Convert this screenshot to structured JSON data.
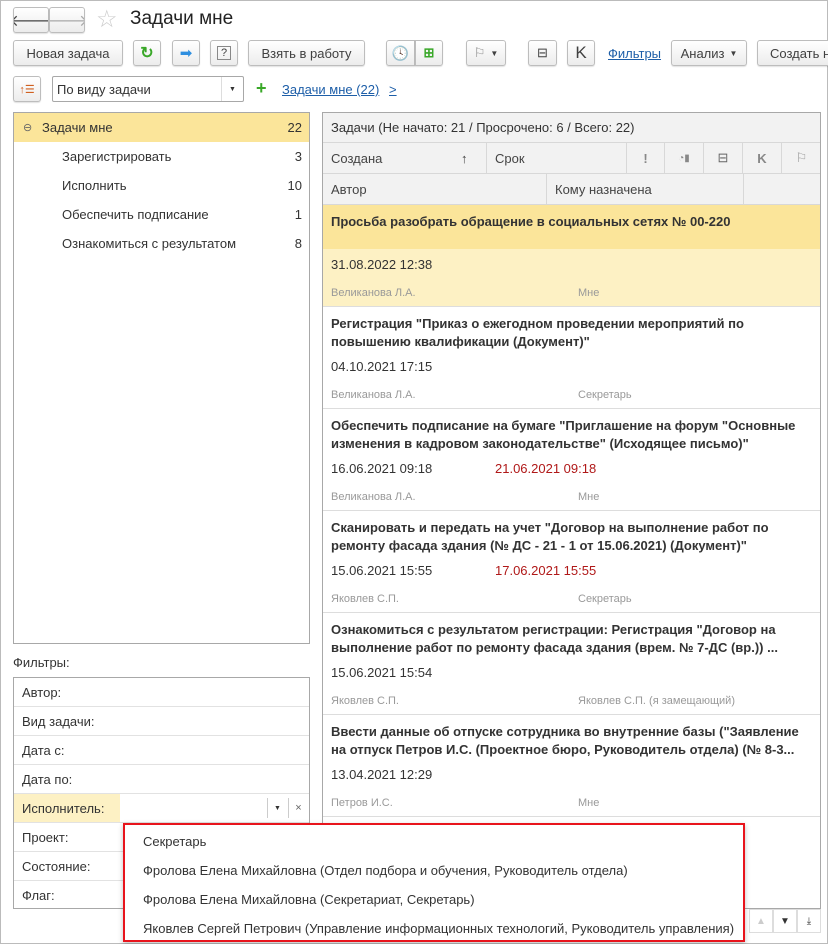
{
  "header": {
    "title": "Задачи мне"
  },
  "toolbar": {
    "new_task": "Новая задача",
    "take_to_work": "Взять в работу",
    "filters": "Фильтры",
    "analysis": "Анализ",
    "create": "Создать на основании"
  },
  "grouping": {
    "select_value": "По виду задачи",
    "breadcrumb": "Задачи мне (22)",
    "arrow": ">"
  },
  "tree": {
    "items": [
      {
        "label": "Задачи мне",
        "count": "22"
      },
      {
        "label": "Зарегистрировать",
        "count": "3"
      },
      {
        "label": "Исполнить",
        "count": "10"
      },
      {
        "label": "Обеспечить подписание",
        "count": "1"
      },
      {
        "label": "Ознакомиться с результатом",
        "count": "8"
      }
    ]
  },
  "filters": {
    "title": "Фильтры:",
    "fields": [
      "Автор:",
      "Вид задачи:",
      "Дата с:",
      "Дата по:",
      "Исполнитель:",
      "Проект:",
      "Состояние:",
      "Флаг:"
    ]
  },
  "tasks_panel": {
    "summary": "Задачи (Не начато: 21 / Просрочено: 6 / Всего: 22)",
    "columns": {
      "created": "Создана",
      "sort_arrow": "↑",
      "due": "Срок",
      "author": "Автор",
      "assignee": "Кому назначена",
      "k": "K",
      "important": "!"
    },
    "rows": [
      {
        "title": "Просьба разобрать обращение в социальных сетях № 00-220",
        "created": "31.08.2022 12:38",
        "due": "",
        "author": "Великанова Л.А.",
        "assignee": "Мне",
        "selected": true
      },
      {
        "title": "Регистрация \"Приказ о ежегодном проведении мероприятий по повышению квалификации (Документ)\"",
        "created": "04.10.2021 17:15",
        "due": "",
        "author": "Великанова Л.А.",
        "assignee": "Секретарь"
      },
      {
        "title": "Обеспечить подписание на бумаге \"Приглашение на форум \"Основные изменения в кадровом законодательстве\" (Исходящее письмо)\"",
        "created": "16.06.2021 09:18",
        "due": "21.06.2021 09:18",
        "author": "Великанова Л.А.",
        "assignee": "Мне"
      },
      {
        "title": "Сканировать и передать на учет \"Договор  на  выполнение работ по ремонту фасада здания (№ ДС - 21 - 1 от 15.06.2021) (Документ)\"",
        "created": "15.06.2021 15:55",
        "due": "17.06.2021 15:55",
        "author": "Яковлев С.П.",
        "assignee": "Секретарь"
      },
      {
        "title": "Ознакомиться с результатом регистрации: Регистрация \"Договор  на выполнение работ по ремонту фасада здания (врем. № 7-ДС (вр.)) ...",
        "created": "15.06.2021 15:54",
        "due": "",
        "author": "Яковлев С.П.",
        "assignee": "Яковлев С.П. (я замещающий)"
      },
      {
        "title": "Ввести данные об отпуске сотрудника во внутренние базы (\"Заявление на отпуск Петров И.С. (Проектное бюро, Руководитель отдела) (№ 8-3...",
        "created": "13.04.2021 12:29",
        "due": "",
        "author": "Петров И.С.",
        "assignee": "Мне"
      }
    ]
  },
  "dropdown": {
    "items": [
      "Секретарь",
      "Фролова Елена Михайловна (Отдел подбора и обучения, Руководитель отдела)",
      "Фролова Елена Михайловна (Секретариат, Секретарь)",
      "Яковлев Сергей Петрович (Управление информационных технологий, Руководитель управления)"
    ]
  },
  "colors": {
    "selected_row": "#fbe59a",
    "selected_row_light": "#fdf1c4",
    "overdue": "#b01818",
    "link": "#1d5ea8",
    "dropdown_border": "#e8141c",
    "accent_green": "#3aa829"
  }
}
